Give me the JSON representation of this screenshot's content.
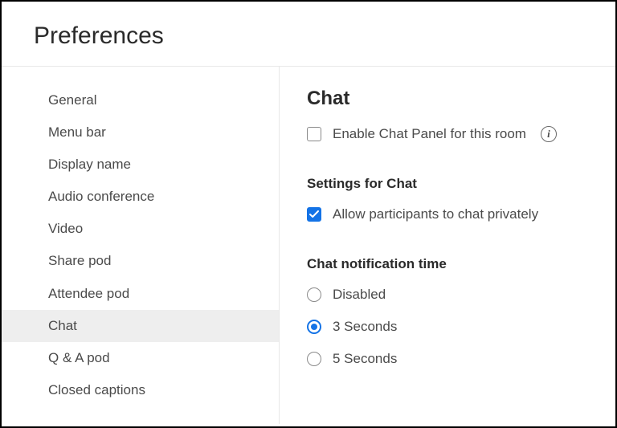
{
  "header": {
    "title": "Preferences"
  },
  "sidebar": {
    "items": [
      {
        "label": "General",
        "selected": false
      },
      {
        "label": "Menu bar",
        "selected": false
      },
      {
        "label": "Display name",
        "selected": false
      },
      {
        "label": "Audio conference",
        "selected": false
      },
      {
        "label": "Video",
        "selected": false
      },
      {
        "label": "Share pod",
        "selected": false
      },
      {
        "label": "Attendee pod",
        "selected": false
      },
      {
        "label": "Chat",
        "selected": true
      },
      {
        "label": "Q & A pod",
        "selected": false
      },
      {
        "label": "Closed captions",
        "selected": false
      }
    ]
  },
  "main": {
    "title": "Chat",
    "enableChatPanel": {
      "label": "Enable Chat Panel for this room",
      "checked": false
    },
    "settingsLabel": "Settings for Chat",
    "allowPrivate": {
      "label": "Allow participants to chat privately",
      "checked": true
    },
    "notificationLabel": "Chat notification time",
    "notificationOptions": [
      {
        "label": "Disabled",
        "selected": false
      },
      {
        "label": "3 Seconds",
        "selected": true
      },
      {
        "label": "5 Seconds",
        "selected": false
      }
    ]
  }
}
